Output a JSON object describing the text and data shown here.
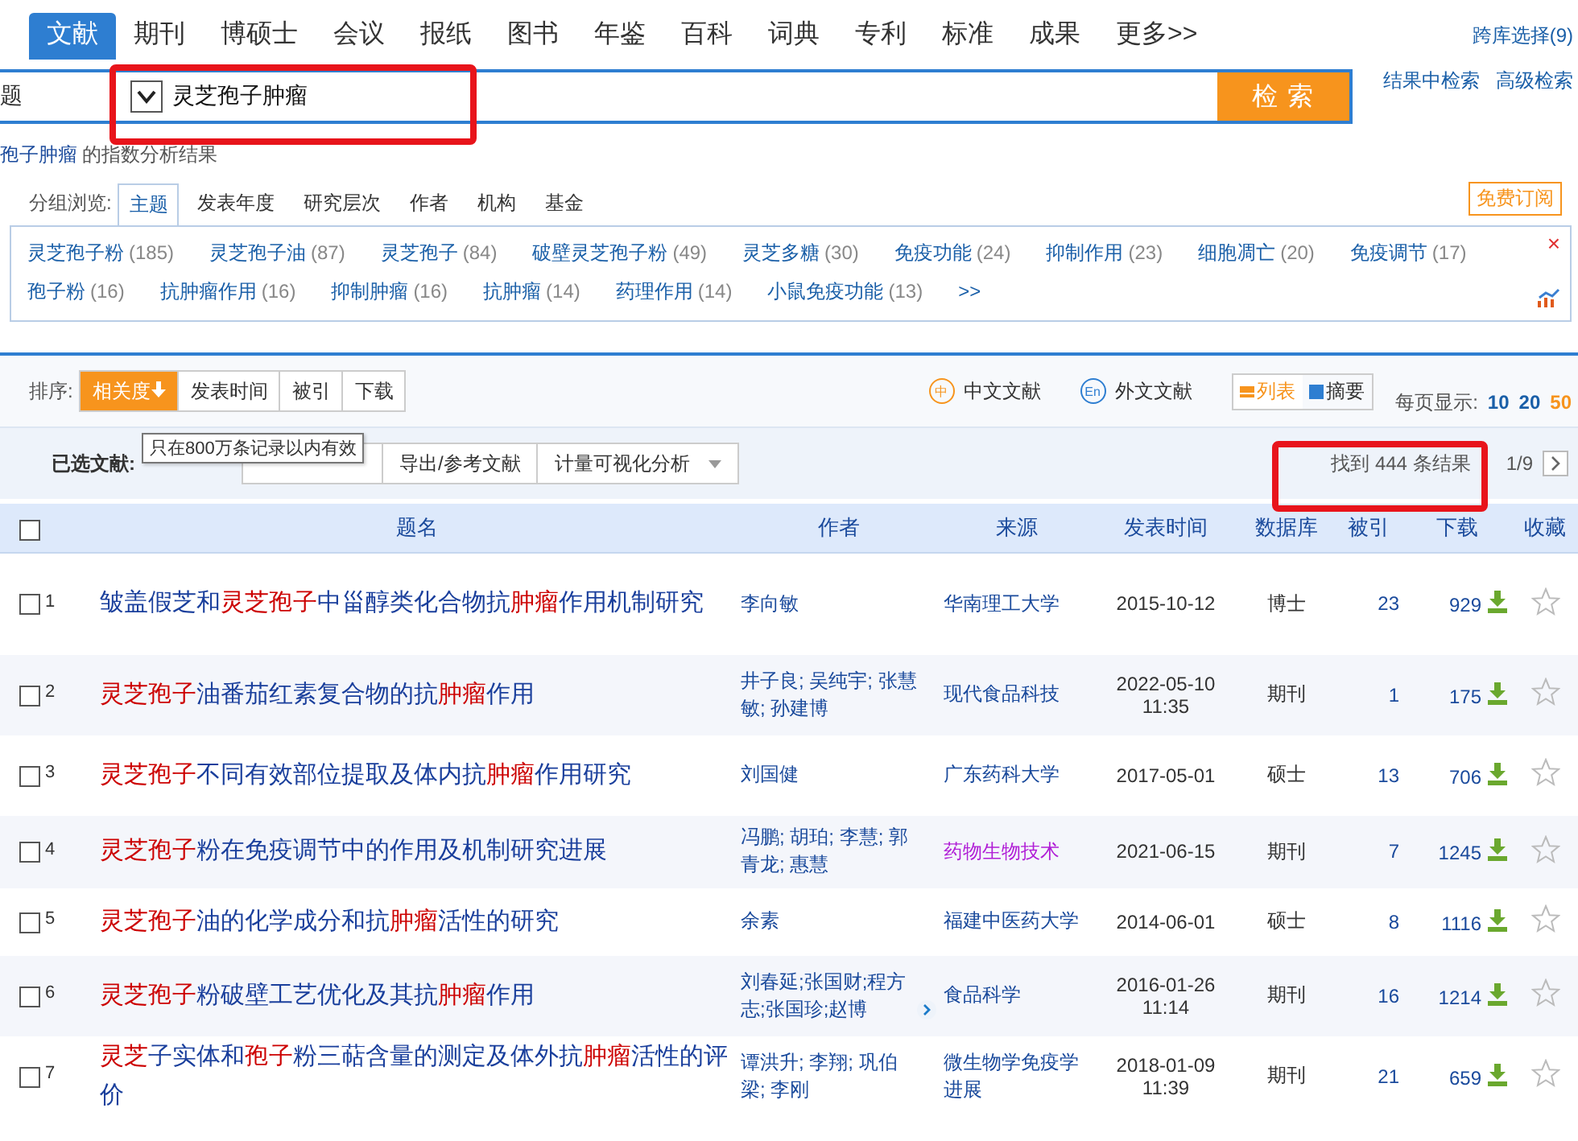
{
  "db_tabs": [
    {
      "label": "文献",
      "selected": true
    },
    {
      "label": "期刊",
      "selected": false
    },
    {
      "label": "博硕士",
      "selected": false
    },
    {
      "label": "会议",
      "selected": false
    },
    {
      "label": "报纸",
      "selected": false
    },
    {
      "label": "图书",
      "selected": false
    },
    {
      "label": "年鉴",
      "selected": false
    },
    {
      "label": "百科",
      "selected": false
    },
    {
      "label": "词典",
      "selected": false
    },
    {
      "label": "专利",
      "selected": false
    },
    {
      "label": "标准",
      "selected": false
    },
    {
      "label": "成果",
      "selected": false
    },
    {
      "label": "更多>>",
      "selected": false
    }
  ],
  "cross_db": "跨库选择(9)",
  "search": {
    "field": "题",
    "value": "灵芝孢子肿瘤",
    "button": "检 索"
  },
  "search_links": [
    "结果中检索",
    "高级检索"
  ],
  "index_note": {
    "link": "孢子肿瘤",
    "text": "的指数分析结果"
  },
  "group": {
    "label": "分组浏览:",
    "tabs": [
      {
        "label": "主题",
        "selected": true
      },
      {
        "label": "发表年度",
        "selected": false
      },
      {
        "label": "研究层次",
        "selected": false
      },
      {
        "label": "作者",
        "selected": false
      },
      {
        "label": "机构",
        "selected": false
      },
      {
        "label": "基金",
        "selected": false
      }
    ],
    "subscribe": "免费订阅",
    "topics": [
      {
        "name": "灵芝孢子粉",
        "count": "(185)"
      },
      {
        "name": "灵芝孢子油",
        "count": "(87)"
      },
      {
        "name": "灵芝孢子",
        "count": "(84)"
      },
      {
        "name": "破壁灵芝孢子粉",
        "count": "(49)"
      },
      {
        "name": "灵芝多糖",
        "count": "(30)"
      },
      {
        "name": "免疫功能",
        "count": "(24)"
      },
      {
        "name": "抑制作用",
        "count": "(23)"
      },
      {
        "name": "细胞凋亡",
        "count": "(20)"
      },
      {
        "name": "免疫调节",
        "count": "(17)"
      },
      {
        "name": "孢子粉",
        "count": "(16)"
      },
      {
        "name": "抗肿瘤作用",
        "count": "(16)"
      },
      {
        "name": "抑制肿瘤",
        "count": "(16)"
      },
      {
        "name": "抗肿瘤",
        "count": "(14)"
      },
      {
        "name": "药理作用",
        "count": "(14)"
      },
      {
        "name": "小鼠免疫功能",
        "count": "(13)"
      }
    ],
    "more": ">>",
    "close": "×"
  },
  "sort": {
    "label": "排序:",
    "options": [
      {
        "label": "相关度",
        "selected": true
      },
      {
        "label": "发表时间",
        "selected": false
      },
      {
        "label": "被引",
        "selected": false
      },
      {
        "label": "下载",
        "selected": false
      }
    ]
  },
  "lang_filters": [
    {
      "icon": "中",
      "label": "中文文献"
    },
    {
      "icon": "En",
      "label": "外文文献"
    }
  ],
  "views": [
    {
      "label": "列表",
      "selected": true
    },
    {
      "label": "摘要",
      "selected": false
    }
  ],
  "page_size": {
    "label": "每页显示:",
    "options": [
      {
        "label": "10",
        "selected": false
      },
      {
        "label": "20",
        "selected": false
      },
      {
        "label": "50",
        "selected": true
      }
    ]
  },
  "toolbar": {
    "label": "已选文献:",
    "buttons": [
      "导出/参考文献",
      "计量可视化分析"
    ]
  },
  "tooltip": "只在800万条记录以内有效",
  "result_count": "找到 444 条结果",
  "pager": "1/9",
  "select_all_checked": false,
  "columns": [
    "题名",
    "作者",
    "来源",
    "发表时间",
    "数据库",
    "被引",
    "下载",
    "收藏"
  ],
  "rows": [
    {
      "no": "1",
      "checked": false,
      "title": "皱盖假芝和**灵芝孢子**中甾醇类化合物抗**肿瘤**作用机制研究",
      "author": "李向敏",
      "more": false,
      "source": "华南理工大学",
      "visited": false,
      "date": "2015-10-12",
      "db": "博士",
      "cited": "23",
      "downloads": "929"
    },
    {
      "no": "2",
      "checked": false,
      "title": "**灵芝孢子**油番茄红素复合物的抗**肿瘤**作用",
      "author": "井子良; 吴纯宇; 张慧敏; 孙建博",
      "more": false,
      "source": "现代食品科技",
      "visited": false,
      "date": "2022-05-10 11:35",
      "db": "期刊",
      "cited": "1",
      "downloads": "175"
    },
    {
      "no": "3",
      "checked": false,
      "title": "**灵芝孢子**不同有效部位提取及体内抗**肿瘤**作用研究",
      "author": "刘国健",
      "more": false,
      "source": "广东药科大学",
      "visited": false,
      "date": "2017-05-01",
      "db": "硕士",
      "cited": "13",
      "downloads": "706"
    },
    {
      "no": "4",
      "checked": false,
      "title": "**灵芝孢子**粉在免疫调节中的作用及机制研究进展",
      "author": "冯鹏; 胡珀; 李慧; 郭青龙; 惠慧",
      "more": false,
      "source": "药物生物技术",
      "visited": true,
      "date": "2021-06-15",
      "db": "期刊",
      "cited": "7",
      "downloads": "1245"
    },
    {
      "no": "5",
      "checked": false,
      "title": "**灵芝孢子**油的化学成分和抗**肿瘤**活性的研究",
      "author": "余素",
      "more": false,
      "source": "福建中医药大学",
      "visited": false,
      "date": "2014-06-01",
      "db": "硕士",
      "cited": "8",
      "downloads": "1116"
    },
    {
      "no": "6",
      "checked": false,
      "title": "**灵芝孢子**粉破壁工艺优化及其抗**肿瘤**作用",
      "author": "刘春延;张国财;程方志;张国珍;赵博",
      "more": true,
      "source": "食品科学",
      "visited": false,
      "date": "2016-01-26 11:14",
      "db": "期刊",
      "cited": "16",
      "downloads": "1214"
    },
    {
      "no": "7",
      "checked": false,
      "title": "**灵芝**子实体和**孢子**粉三萜含量的测定及体外抗**肿瘤**活性的评价",
      "author": "谭洪升; 李翔; 巩伯梁; 李刚",
      "more": false,
      "source": "微生物学免疫学进展",
      "visited": false,
      "date": "2018-01-09 11:39",
      "db": "期刊",
      "cited": "21",
      "downloads": "659"
    }
  ]
}
